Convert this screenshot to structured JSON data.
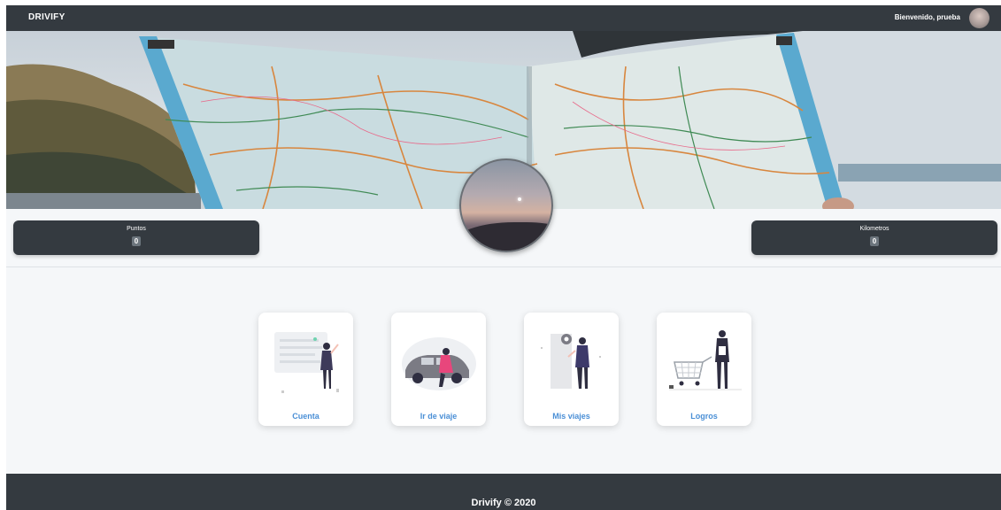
{
  "navbar": {
    "brand": "DRIVIFY",
    "welcome": "Bienvenido, prueba",
    "avatar_icon": "user-avatar"
  },
  "banner": {
    "image_icon": "road-map-photo"
  },
  "stats": {
    "points": {
      "label": "Puntos",
      "value": "0"
    },
    "km": {
      "label": "Kilometros",
      "value": "0"
    }
  },
  "cards": [
    {
      "label": "Cuenta",
      "icon": "account-illustration"
    },
    {
      "label": "Ir de viaje",
      "icon": "car-illustration"
    },
    {
      "label": "Mis viajes",
      "icon": "map-pin-illustration"
    },
    {
      "label": "Logros",
      "icon": "shopping-cart-illustration"
    }
  ],
  "footer": {
    "text": "Drivify © 2020"
  },
  "colors": {
    "dark": "#343a40",
    "accent": "#4a8fd6",
    "badge": "#6c757d"
  }
}
